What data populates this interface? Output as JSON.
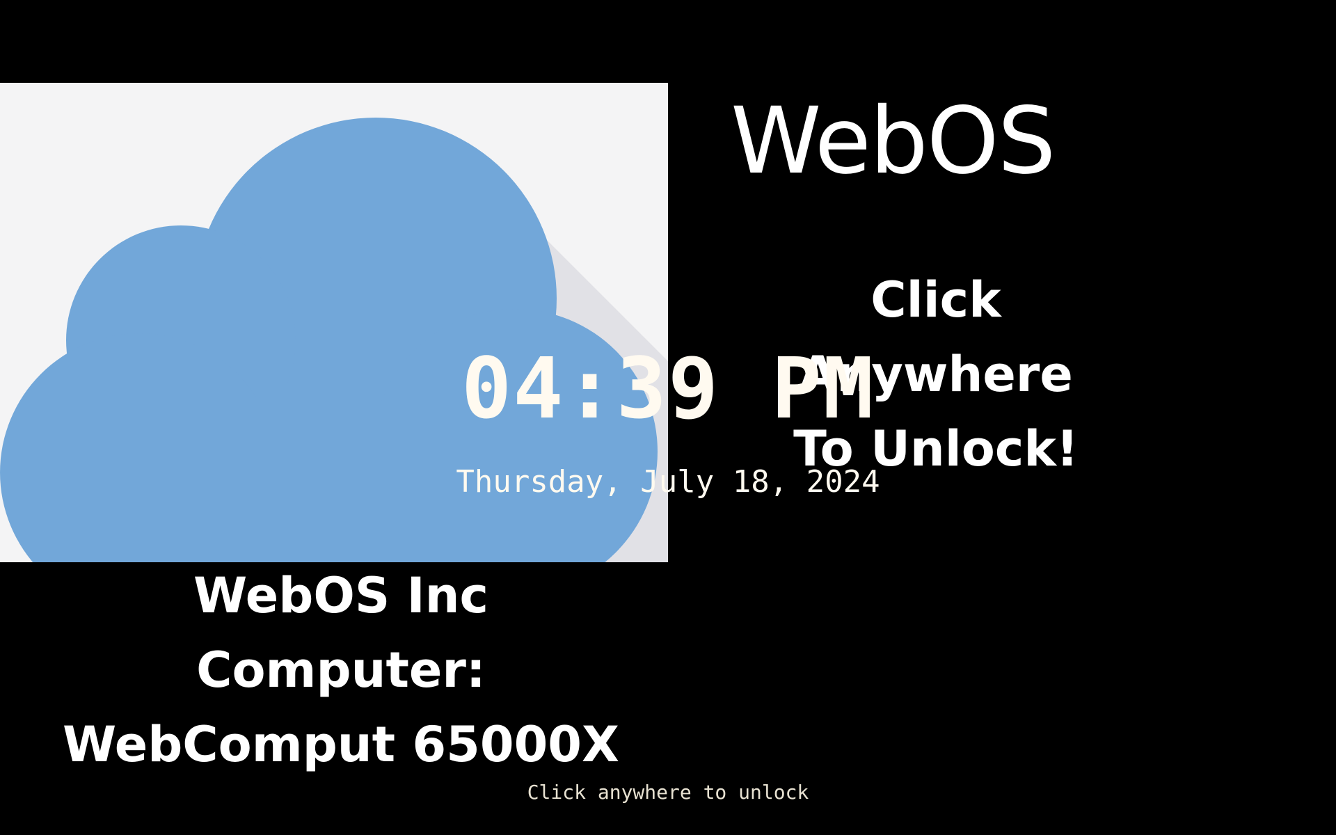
{
  "wallpaper": {
    "brand_title": "WebOS",
    "unlock_headline": [
      "Click",
      "Anywhere",
      "To Unlock!"
    ],
    "device_info": [
      "WebOS Inc",
      "Computer:",
      "WebComput 65000X"
    ],
    "logo_icon": "cloud-icon",
    "colors": {
      "background": "#000000",
      "logo_panel": "#f4f4f5",
      "cloud": "#72a7d9",
      "cloud_shadow": "#e1e1e6",
      "text": "#ffffff"
    }
  },
  "lock": {
    "time": "04:39 PM",
    "date": "Thursday, July 18, 2024",
    "hint": "Click anywhere to unlock"
  }
}
